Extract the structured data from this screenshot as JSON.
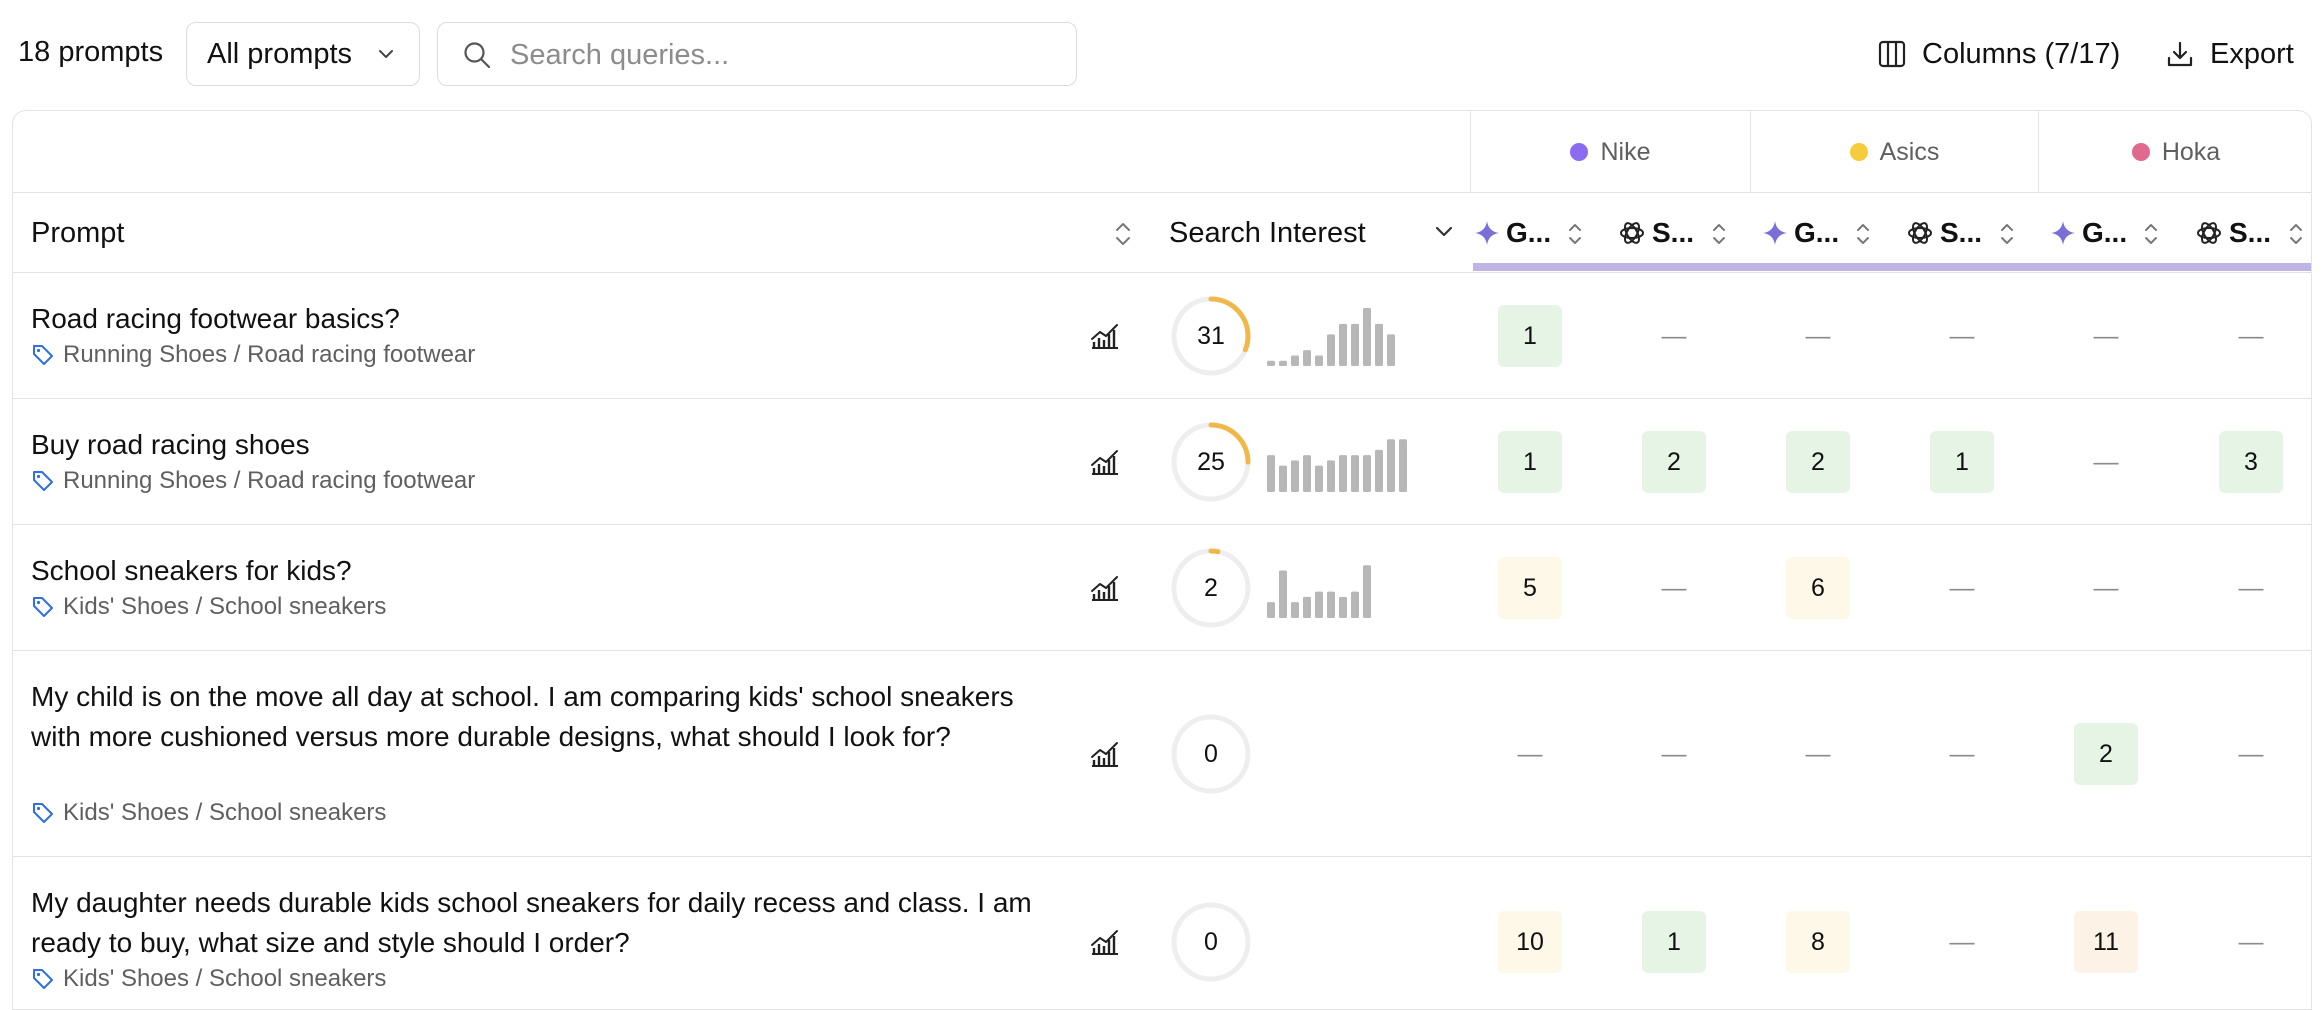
{
  "toolbar": {
    "count_label": "18 prompts",
    "filter_value": "All prompts",
    "search_placeholder": "Search queries...",
    "columns_label": "Columns (7/17)",
    "export_label": "Export"
  },
  "brands": [
    {
      "name": "Nike",
      "color": "#8b6cf0"
    },
    {
      "name": "Asics",
      "color": "#f5cc3c"
    },
    {
      "name": "Hoka",
      "color": "#e06a8f"
    }
  ],
  "columns": {
    "prompt": "Prompt",
    "search_interest": "Search Interest",
    "models": [
      "G...",
      "S...",
      "G...",
      "S...",
      "G...",
      "S..."
    ]
  },
  "colors": {
    "gauge_arc": "#f0b84a",
    "gauge_track": "#eeeeee",
    "rank_green": "#e6f4e6",
    "rank_yellow": "#fdf8e8",
    "rank_orange": "#fdf2e6",
    "model_strip": "#bfb4e6",
    "gemini": "#7a6fd8"
  },
  "rows": [
    {
      "prompt": "Road racing footwear basics?",
      "tag": "Running Shoes / Road racing footwear",
      "interest": "31",
      "interest_fraction": 0.31,
      "spark": [
        1,
        1,
        2,
        3,
        2,
        6,
        8,
        8,
        11,
        8,
        6
      ],
      "ranks": [
        "1",
        "—",
        "—",
        "—",
        "—",
        "—"
      ]
    },
    {
      "prompt": "Buy road racing shoes",
      "tag": "Running Shoes / Road racing footwear",
      "interest": "25",
      "interest_fraction": 0.25,
      "spark": [
        7,
        5,
        6,
        7,
        5,
        6,
        7,
        7,
        7,
        8,
        10,
        10
      ],
      "ranks": [
        "1",
        "2",
        "2",
        "1",
        "—",
        "3"
      ]
    },
    {
      "prompt": "School sneakers for kids?",
      "tag": "Kids' Shoes / School sneakers",
      "interest": "2",
      "interest_fraction": 0.02,
      "spark": [
        3,
        9,
        3,
        4,
        5,
        5,
        4,
        5,
        10
      ],
      "ranks": [
        "5",
        "—",
        "6",
        "—",
        "—",
        "—"
      ]
    },
    {
      "prompt": "My child is on the move all day at school. I am comparing kids' school sneakers with more cushioned versus more durable designs, what should I look for?",
      "tag": "Kids' Shoes / School sneakers",
      "interest": "0",
      "interest_fraction": 0,
      "spark": [],
      "ranks": [
        "—",
        "—",
        "—",
        "—",
        "2",
        "—"
      ]
    },
    {
      "prompt": "My daughter needs durable kids school sneakers for daily recess and class. I am ready to buy, what size and style should I order?",
      "tag": "Kids' Shoes / School sneakers",
      "interest": "0",
      "interest_fraction": 0,
      "spark": [],
      "ranks": [
        "10",
        "1",
        "8",
        "—",
        "11",
        "—"
      ]
    }
  ]
}
